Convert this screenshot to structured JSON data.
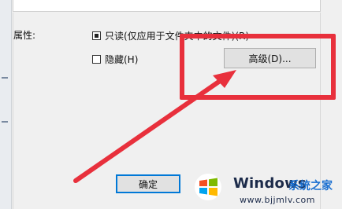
{
  "attributes": {
    "label": "属性:",
    "readonly_label": "只读(仅应用于文件夹中的文件)(R)",
    "readonly_state": "indeterminate",
    "hidden_label": "隐藏(H)",
    "hidden_state": "unchecked",
    "advanced_button": "高级(D)..."
  },
  "footer": {
    "ok_button": "确定"
  },
  "annotation": {
    "color": "#e8303c"
  },
  "watermark": {
    "title": "Windows",
    "chinese": "系统之家",
    "url": "www.bjjmlv.com"
  }
}
